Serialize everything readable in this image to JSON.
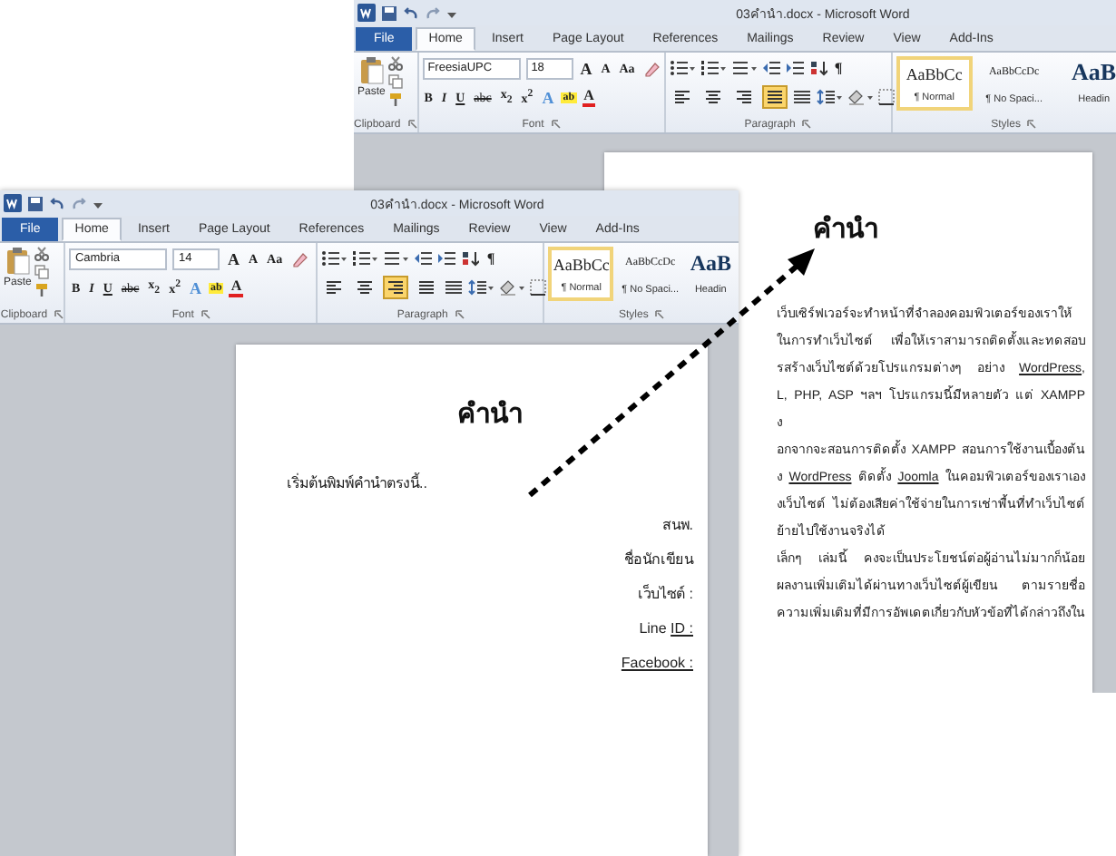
{
  "windows": [
    {
      "title": "03คำนำ.docx - Microsoft Word",
      "tabs": [
        {
          "label": "File",
          "selected": false
        },
        {
          "label": "Home",
          "selected": true
        },
        {
          "label": "Insert",
          "selected": false
        },
        {
          "label": "Page Layout",
          "selected": false
        },
        {
          "label": "References",
          "selected": false
        },
        {
          "label": "Mailings",
          "selected": false
        },
        {
          "label": "Review",
          "selected": false
        },
        {
          "label": "View",
          "selected": false
        },
        {
          "label": "Add-Ins",
          "selected": false
        }
      ],
      "clipboard": {
        "paste_label": "Paste",
        "group_label": "Clipboard"
      },
      "font": {
        "name": "FreesiaUPC",
        "size": "18",
        "row1": [
          {
            "kind": "grow",
            "label": "A"
          },
          {
            "kind": "shrink",
            "label": "A"
          },
          {
            "kind": "case",
            "label": "Aa"
          }
        ],
        "row2": [
          {
            "kind": "bold",
            "label": "B"
          },
          {
            "kind": "italic",
            "label": "I"
          },
          {
            "kind": "underline",
            "label": "U"
          },
          {
            "kind": "strike",
            "label": "abc"
          },
          {
            "kind": "sub",
            "label": "x$_{2}$"
          },
          {
            "kind": "sup",
            "label": "x$^{2}$"
          },
          {
            "kind": "effects",
            "label": "A"
          },
          {
            "kind": "highlight",
            "label": "ab"
          },
          {
            "kind": "color",
            "label": "A"
          }
        ],
        "group_label": "Font"
      },
      "paragraph": {
        "pilcrow": "¶",
        "alignments": [
          {
            "kind": "left",
            "selected": false
          },
          {
            "kind": "center",
            "selected": false
          },
          {
            "kind": "right",
            "selected": false
          },
          {
            "kind": "justify",
            "selected": true
          }
        ],
        "group_label": "Paragraph"
      },
      "styles": {
        "items": [
          {
            "preview": "AaBbCc",
            "label": "¶ Normal",
            "selected": true
          },
          {
            "preview": "AaBbCcDc",
            "label": "¶ No Spaci...",
            "selected": false
          },
          {
            "preview": "AaB",
            "label": "Headin",
            "selected": false
          }
        ],
        "group_label": "Styles"
      },
      "document": {
        "heading": "คำนำ",
        "lines": [
          {
            "kind": "justified",
            "segments": [
              {
                "text": "เว็บเซิร์ฟเวอร์จะทำหน้าที่จำลองคอมพิวเตอร์ของเราให้",
                "underlined": false
              }
            ]
          },
          {
            "kind": "justified",
            "segments": [
              {
                "text": "ในการทำเว็บไซต์  เพื่อให้เราสามารถติดตั้งและทดสอบ",
                "underlined": false
              }
            ]
          },
          {
            "kind": "justified",
            "segments": [
              {
                "text": "รสร้างเว็บไซต์ด้วยโปรแกรมต่างๆ  อย่าง ",
                "underlined": false
              },
              {
                "text": "WordPress",
                "underlined": true
              },
              {
                "text": ",",
                "underlined": false
              }
            ]
          },
          {
            "kind": "justified",
            "segments": [
              {
                "text": "L, PHP, ASP ฯลฯ โปรแกรมนี้มีหลายตัว แต่ XAMPP",
                "underlined": false
              }
            ]
          },
          {
            "kind": "left",
            "segments": [
              {
                "text": "ง",
                "underlined": false
              }
            ]
          },
          {
            "kind": "justified",
            "segments": [
              {
                "text": "อกจากจะสอนการติดตั้ง XAMPP สอนการใช้งานเบื้องต้น",
                "underlined": false
              }
            ]
          },
          {
            "kind": "justified",
            "segments": [
              {
                "text": "ง ",
                "underlined": false
              },
              {
                "text": "WordPress",
                "underlined": true
              },
              {
                "text": " ติดตั้ง ",
                "underlined": false
              },
              {
                "text": "Joomla",
                "underlined": true
              },
              {
                "text": " ในคอมพิวเตอร์ของเราเอง",
                "underlined": false
              }
            ]
          },
          {
            "kind": "justified",
            "segments": [
              {
                "text": "งเว็บไซต์  ไม่ต้องเสียค่าใช้จ่ายในการเช่าพื้นที่ทำเว็บไซต์",
                "underlined": false
              }
            ]
          },
          {
            "kind": "left",
            "segments": [
              {
                "text": "ย้ายไปใช้งานจริงได้",
                "underlined": false
              }
            ]
          },
          {
            "kind": "justified",
            "segments": [
              {
                "text": "เล็กๆ  เล่มนี้  คงจะเป็นประโยชน์ต่อผู้อ่านไม่มากก็น้อย",
                "underlined": false
              }
            ]
          },
          {
            "kind": "justified",
            "segments": [
              {
                "text": "ผลงานเพิ่มเติมได้ผ่านทางเว็บไซต์ผู้เขียน   ตามรายชื่อ",
                "underlined": false
              }
            ]
          },
          {
            "kind": "justified",
            "segments": [
              {
                "text": "ความเพิ่มเติมที่มีการอัพเดตเกี่ยวกับหัวข้อที่ได้กล่าวถึงใน",
                "underlined": false
              }
            ]
          }
        ]
      }
    },
    {
      "title": "03คำนำ.docx - Microsoft Word",
      "tabs": [
        {
          "label": "File",
          "selected": false
        },
        {
          "label": "Home",
          "selected": true
        },
        {
          "label": "Insert",
          "selected": false
        },
        {
          "label": "Page Layout",
          "selected": false
        },
        {
          "label": "References",
          "selected": false
        },
        {
          "label": "Mailings",
          "selected": false
        },
        {
          "label": "Review",
          "selected": false
        },
        {
          "label": "View",
          "selected": false
        },
        {
          "label": "Add-Ins",
          "selected": false
        }
      ],
      "clipboard": {
        "paste_label": "Paste",
        "group_label": "Clipboard"
      },
      "font": {
        "name": "Cambria",
        "size": "14",
        "row1": [
          {
            "kind": "grow",
            "label": "A"
          },
          {
            "kind": "shrink",
            "label": "A"
          },
          {
            "kind": "case",
            "label": "Aa"
          }
        ],
        "row2": [
          {
            "kind": "bold",
            "label": "B"
          },
          {
            "kind": "italic",
            "label": "I"
          },
          {
            "kind": "underline",
            "label": "U"
          },
          {
            "kind": "strike",
            "label": "abc"
          },
          {
            "kind": "sub",
            "label": "x$_{2}$"
          },
          {
            "kind": "sup",
            "label": "x$^{2}$"
          },
          {
            "kind": "effects",
            "label": "A"
          },
          {
            "kind": "highlight",
            "label": "ab"
          },
          {
            "kind": "color",
            "label": "A"
          }
        ],
        "group_label": "Font"
      },
      "paragraph": {
        "pilcrow": "¶",
        "alignments": [
          {
            "kind": "left",
            "selected": false
          },
          {
            "kind": "center",
            "selected": false
          },
          {
            "kind": "right",
            "selected": true
          },
          {
            "kind": "justify",
            "selected": false
          }
        ],
        "group_label": "Paragraph"
      },
      "styles": {
        "items": [
          {
            "preview": "AaBbCc",
            "label": "¶ Normal",
            "selected": true
          },
          {
            "preview": "AaBbCcDc",
            "label": "¶ No Spaci...",
            "selected": false
          },
          {
            "preview": "AaB",
            "label": "Headin",
            "selected": false
          }
        ],
        "group_label": "Styles"
      },
      "document": {
        "heading": "คำนำ",
        "lines": [
          {
            "kind": "left",
            "segments": [
              {
                "text": "เริ่มต้นพิมพ์คำนำตรงนี้..",
                "underlined": false
              }
            ]
          },
          {
            "kind": "right",
            "segments": [
              {
                "text": "สนพ.",
                "underlined": false
              }
            ]
          },
          {
            "kind": "right",
            "segments": [
              {
                "text": "ชื่อนักเขียน",
                "underlined": false
              }
            ]
          },
          {
            "kind": "right",
            "segments": [
              {
                "text": "เว็บไซต์ :",
                "underlined": false
              }
            ]
          },
          {
            "kind": "right",
            "segments": [
              {
                "text": "Line ",
                "underlined": false
              },
              {
                "text": "ID :",
                "underlined": true
              }
            ]
          },
          {
            "kind": "right",
            "segments": [
              {
                "text": "Facebook :",
                "underlined": true
              }
            ]
          }
        ]
      }
    }
  ]
}
